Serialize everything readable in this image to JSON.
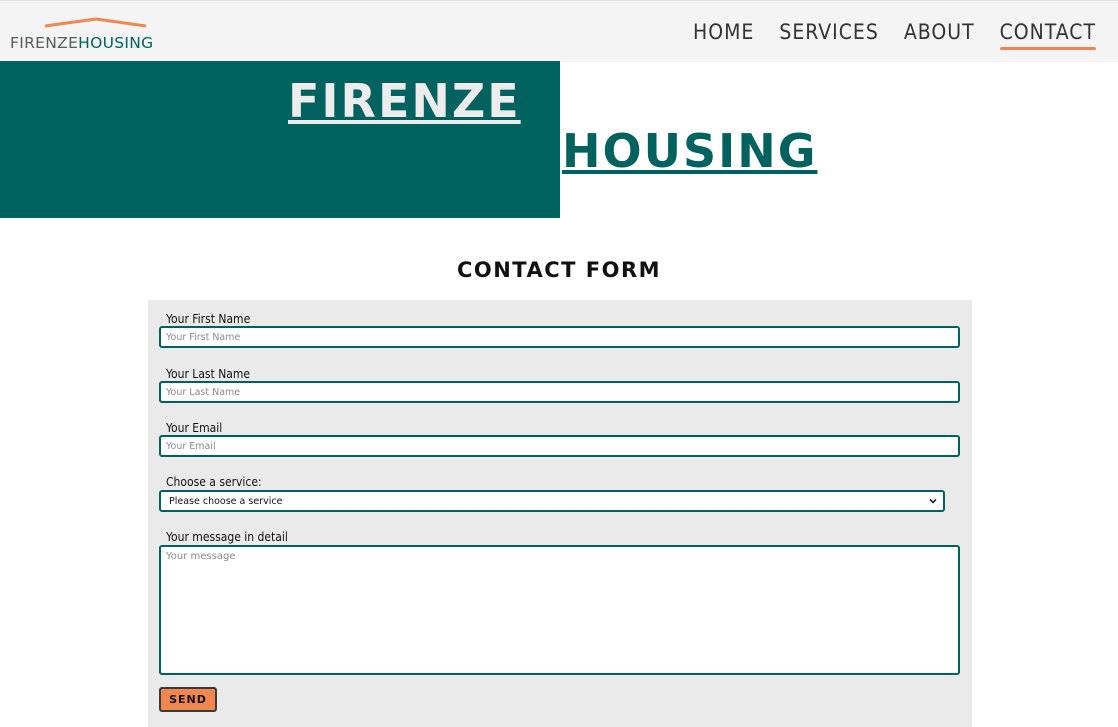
{
  "brand": {
    "logo_part1": "FIRENZE",
    "logo_part2": "HOUSING",
    "primary_color": "#00625e",
    "accent_color": "#f0874f"
  },
  "nav": {
    "items": [
      {
        "label": "HOME"
      },
      {
        "label": "SERVICES"
      },
      {
        "label": "ABOUT"
      },
      {
        "label": "CONTACT"
      }
    ],
    "active": "CONTACT"
  },
  "hero": {
    "word1": "FIRENZE",
    "word2": "HOUSING"
  },
  "form": {
    "title": "CONTACT FORM",
    "first_name_label": "Your First Name",
    "first_name_placeholder": "Your First Name",
    "last_name_label": "Your Last Name",
    "last_name_placeholder": "Your Last Name",
    "email_label": "Your Email",
    "email_placeholder": "Your Email",
    "service_label": "Choose a service:",
    "service_selected": "Please choose a service",
    "message_label": "Your message in detail",
    "message_placeholder": "Your message",
    "send_label": "SEND"
  }
}
